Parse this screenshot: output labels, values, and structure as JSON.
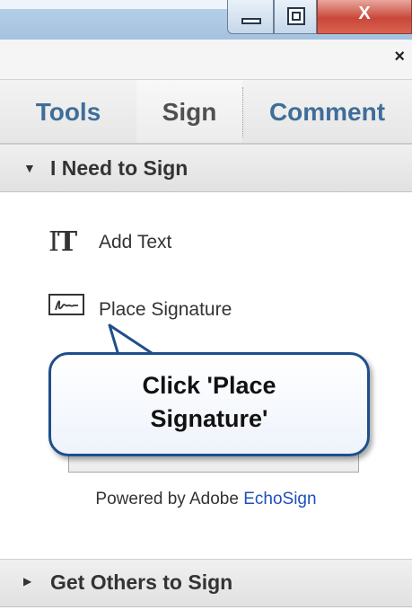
{
  "window": {
    "buttons": {
      "minimize_icon": "minimize-icon",
      "maximize_icon": "maximize-icon",
      "close_label": "X"
    }
  },
  "pane": {
    "close_label": "×"
  },
  "tabs": [
    {
      "label": "Tools"
    },
    {
      "label": "Sign"
    },
    {
      "label": "Comment"
    }
  ],
  "sections": {
    "need_to_sign": {
      "label": "I Need to Sign",
      "expanded": true
    },
    "get_others": {
      "label": "Get Others to Sign",
      "expanded": false
    }
  },
  "items": {
    "add_text": {
      "label": "Add Text",
      "icon": "add-text-icon"
    },
    "place_signature": {
      "label": "Place Signature",
      "icon": "signature-icon"
    }
  },
  "powered_by": {
    "prefix": "Powered by Adobe",
    "brand": "EchoSign"
  },
  "callout": {
    "line1": "Click 'Place",
    "line2": "Signature'"
  },
  "colors": {
    "tab_link": "#3f6e99",
    "brand_blue": "#1f4fbd",
    "callout_border": "#1f4f8a"
  }
}
